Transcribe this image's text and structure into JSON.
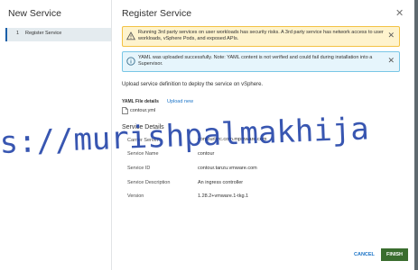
{
  "wizard": {
    "title": "New Service",
    "steps": [
      {
        "number": "1",
        "label": "Register Service"
      }
    ]
  },
  "dialog": {
    "title": "Register Service",
    "close_icon": "close-icon"
  },
  "banners": {
    "warning": {
      "text": "Running 3rd party services on user workloads has security risks. A 3rd party service has network access to user workloads, vSphere Pods, and exposed APIs.",
      "icon": "warning-icon",
      "color": "#f3c244"
    },
    "info": {
      "text": "YAML was uploaded successfully. Note: YAML content is not verified and could fail during installation into a Supervisor.",
      "icon": "info-icon",
      "color": "#79c6e6"
    }
  },
  "upload": {
    "intro": "Upload service definition to deploy the service on vSphere.",
    "yaml_label": "YAML File details",
    "upload_link": "Upload new",
    "file_name": "contour.yml"
  },
  "details": {
    "section_title": "Service Details",
    "rows": [
      {
        "label": "Carrier Server",
        "value": "contourlsrc.com.mpmware.com"
      },
      {
        "label": "Service Name",
        "value": "contour"
      },
      {
        "label": "Service ID",
        "value": "contour.tanzu.vmware.com"
      },
      {
        "label": "Service Description",
        "value": "An ingress controller"
      },
      {
        "label": "Version",
        "value": "1.28.2+vmware.1-tkg.1"
      }
    ]
  },
  "footer": {
    "cancel_label": "CANCEL",
    "finish_label": "FINISH"
  },
  "watermark": {
    "text": "s://murishpalmakhija"
  },
  "colors": {
    "accent": "#1a5fa8",
    "link": "#1a73c7",
    "finish_button": "#3a6d2e",
    "watermark": "#1d3fa6"
  }
}
